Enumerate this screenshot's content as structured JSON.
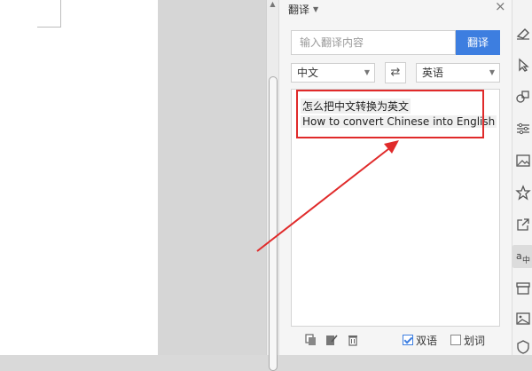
{
  "panel": {
    "title": "翻译",
    "search_placeholder": "输入翻译内容",
    "translate_label": "翻译",
    "source_lang": "中文",
    "target_lang": "英语",
    "result": {
      "source_text": "怎么把中文转换为英文",
      "translated_text": "How to convert Chinese into English"
    },
    "bilingual_label": "双语",
    "bilingual_checked": true,
    "word_select_label": "划词",
    "word_select_checked": false
  },
  "icons": {
    "panel_close": "close-icon",
    "swap": "swap-icon",
    "bottom_tools": [
      "copy-icon",
      "edit-icon",
      "trash-icon"
    ],
    "right_toolbar": [
      "eraser-icon",
      "cursor-icon",
      "shapes-icon",
      "sliders-icon",
      "image-icon",
      "star-icon",
      "share-icon",
      "translate-icon",
      "archive-icon",
      "picture-icon",
      "shield-icon"
    ]
  },
  "colors": {
    "accent": "#3d7ee0",
    "annotation": "#e02a2a"
  }
}
